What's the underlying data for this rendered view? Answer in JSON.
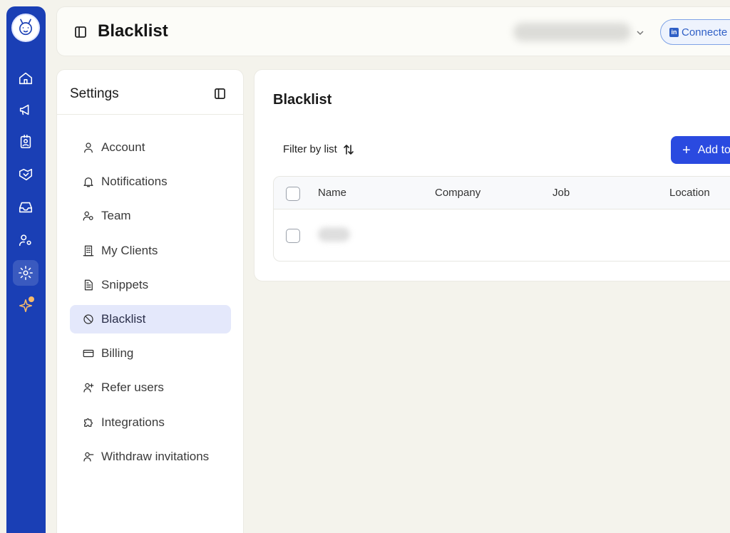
{
  "header": {
    "title": "Blacklist",
    "connected_label": "Connecte",
    "linkedin_badge": "in"
  },
  "settings": {
    "title": "Settings",
    "items": [
      {
        "label": "Account",
        "icon": "user-icon"
      },
      {
        "label": "Notifications",
        "icon": "bell-icon"
      },
      {
        "label": "Team",
        "icon": "team-icon"
      },
      {
        "label": "My Clients",
        "icon": "building-icon"
      },
      {
        "label": "Snippets",
        "icon": "document-icon"
      },
      {
        "label": "Blacklist",
        "icon": "ban-icon",
        "active": true
      },
      {
        "label": "Billing",
        "icon": "credit-card-icon"
      },
      {
        "label": "Refer users",
        "icon": "user-plus-icon"
      },
      {
        "label": "Integrations",
        "icon": "puzzle-icon"
      },
      {
        "label": "Withdraw invitations",
        "icon": "user-minus-icon"
      }
    ]
  },
  "main": {
    "title": "Blacklist",
    "filter_label": "Filter by list",
    "add_button_label": "Add to",
    "table": {
      "columns": [
        "Name",
        "Company",
        "Job",
        "Location"
      ]
    }
  },
  "colors": {
    "rail": "#1a3fb5",
    "accent": "#2a4ae0",
    "active_item_bg": "#e4e8fb",
    "sparkle": "#f6b96a"
  }
}
